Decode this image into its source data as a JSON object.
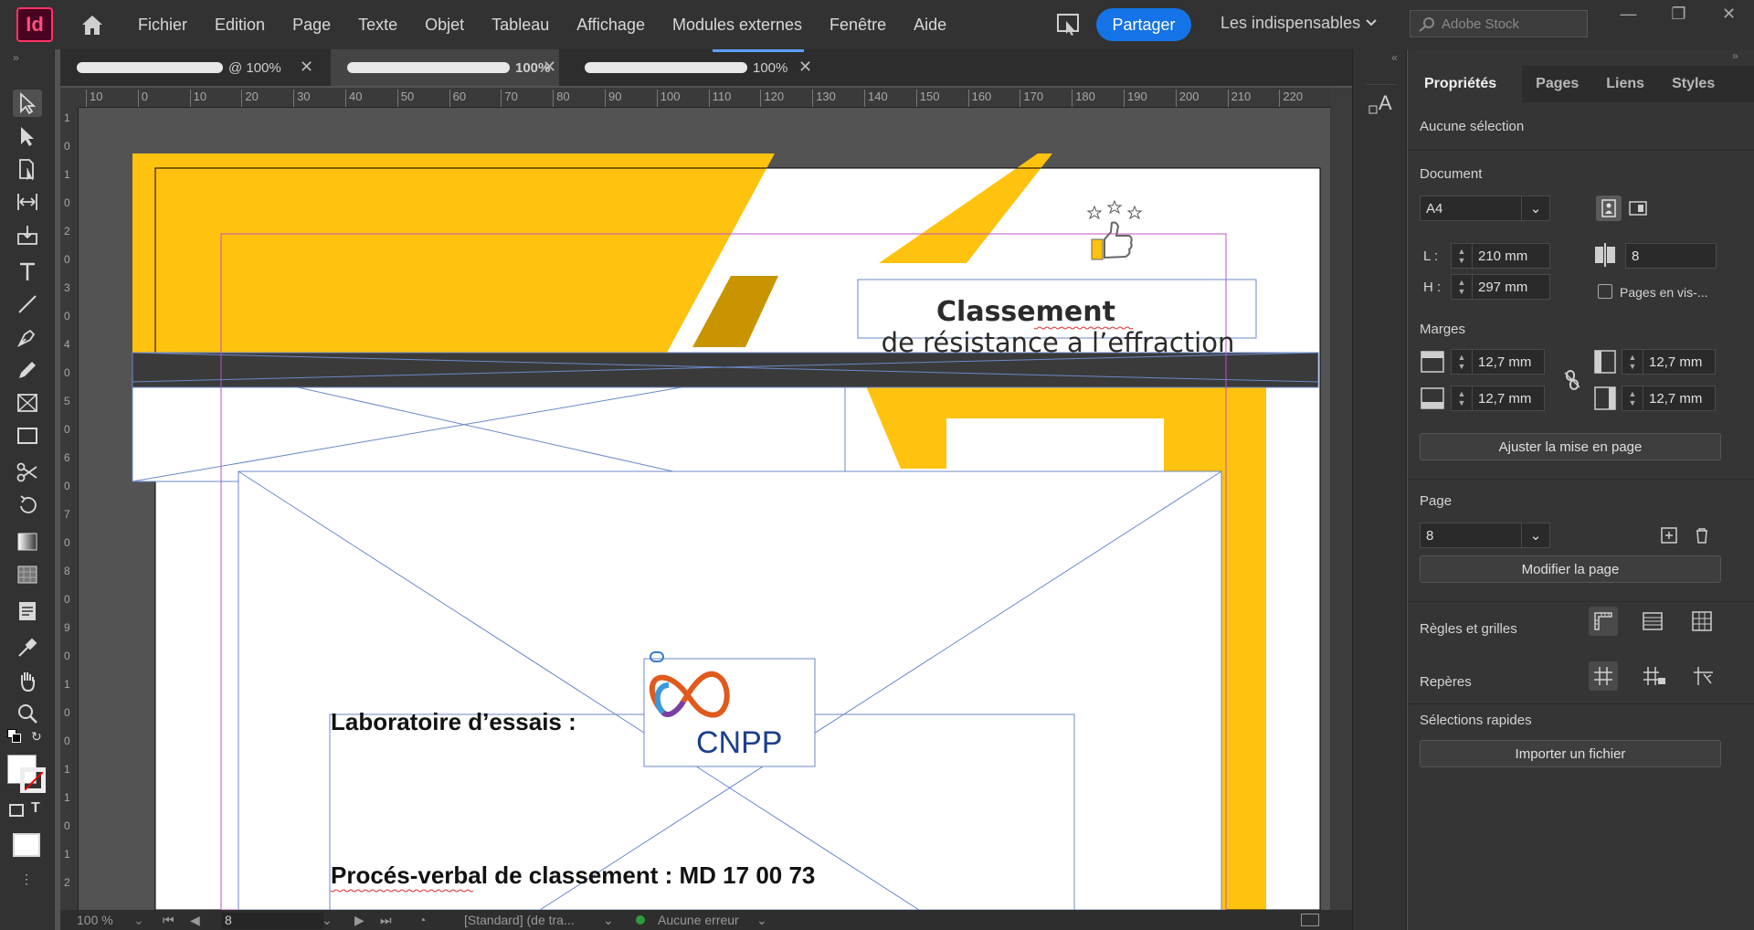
{
  "app": {
    "logo": "Id"
  },
  "menu": [
    "Fichier",
    "Edition",
    "Page",
    "Texte",
    "Objet",
    "Tableau",
    "Affichage",
    "Modules externes",
    "Fenêtre",
    "Aide"
  ],
  "topbar": {
    "share_label": "Partager",
    "workspace": "Les indispensables",
    "stock_placeholder": "Adobe Stock"
  },
  "tabs": [
    {
      "zoom": "@ 100%",
      "active": false
    },
    {
      "zoom": "100%",
      "active": true
    },
    {
      "zoom": "100%",
      "active": false
    }
  ],
  "ruler": {
    "h": [
      "10",
      "0",
      "10",
      "20",
      "30",
      "40",
      "50",
      "60",
      "70",
      "80",
      "90",
      "100",
      "110",
      "120",
      "130",
      "140",
      "150",
      "160",
      "170",
      "180",
      "190",
      "200",
      "210",
      "220"
    ],
    "v": [
      "1",
      "0",
      "1",
      "0",
      "2",
      "0",
      "3",
      "0",
      "4",
      "0",
      "5",
      "0",
      "6",
      "0",
      "7",
      "0",
      "8",
      "0",
      "9",
      "0",
      "1",
      "0",
      "0",
      "1",
      "1",
      "0",
      "1",
      "2"
    ]
  },
  "document": {
    "title_bold": "Classement",
    "title_line2": "de résistance a l’effraction",
    "lab_label": "Laboratoire d’essais :",
    "pv_label": "Procés-verbal de classement : MD 17 00 73",
    "logo_text": "CNPP"
  },
  "status": {
    "zoom": "100 %",
    "page": "8",
    "style": "[Standard] (de tra...",
    "errors": "Aucune erreur"
  },
  "props": {
    "tabs": [
      "Propriétés",
      "Pages",
      "Liens",
      "Styles"
    ],
    "no_selection": "Aucune sélection",
    "document_heading": "Document",
    "page_size": "A4",
    "width_label": "L :",
    "width": "210 mm",
    "height_label": "H :",
    "height": "297 mm",
    "pages_count": "8",
    "facing_pages": "Pages en vis-...",
    "margins_heading": "Marges",
    "margin_top": "12,7 mm",
    "margin_bottom": "12,7 mm",
    "margin_left": "12,7 mm",
    "margin_right": "12,7 mm",
    "adjust_layout": "Ajuster la mise en page",
    "page_heading": "Page",
    "page_value": "8",
    "edit_page": "Modifier la page",
    "rulers_grids": "Règles et grilles",
    "guides": "Repères",
    "quick_actions": "Sélections rapides",
    "import_file": "Importer un fichier"
  },
  "colors": {
    "accent": "#1473e6",
    "yellow": "#ffc20e",
    "dark_yellow": "#c89500",
    "doc_dark": "#3a3a3a",
    "cnpp_blue": "#1d3f8f"
  }
}
